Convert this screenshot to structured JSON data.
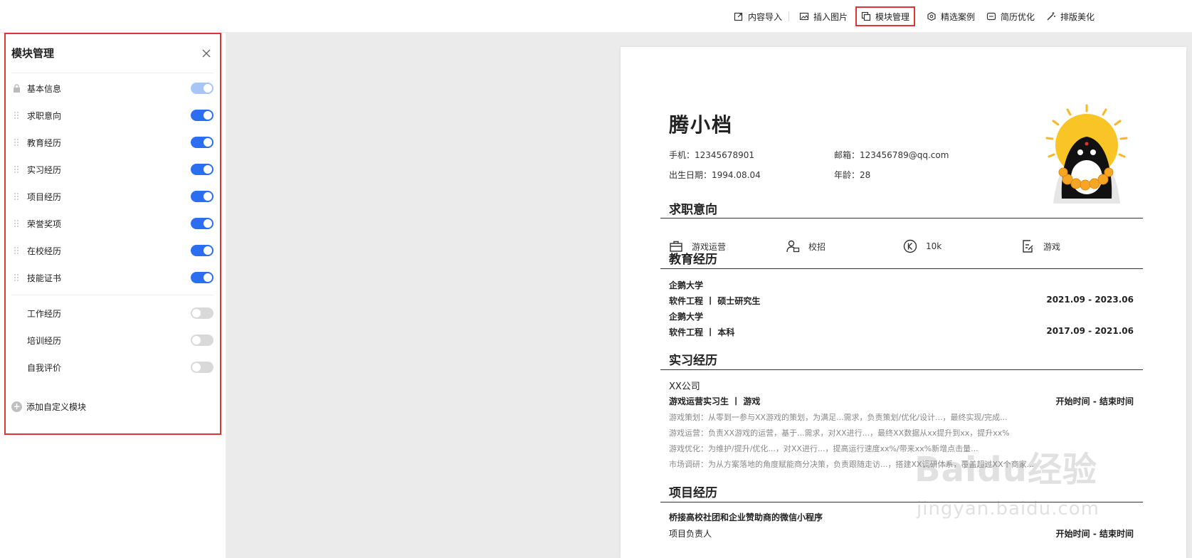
{
  "toolbar": {
    "items": [
      {
        "label": "内容导入",
        "icon": "import-icon"
      },
      {
        "label": "插入图片",
        "icon": "image-icon"
      },
      {
        "label": "模块管理",
        "icon": "modules-icon",
        "active": true
      },
      {
        "label": "精选案例",
        "icon": "cases-icon"
      },
      {
        "label": "简历优化",
        "icon": "optimize-icon"
      },
      {
        "label": "排版美化",
        "icon": "beautify-icon"
      }
    ]
  },
  "panel": {
    "title": "模块管理",
    "modules": [
      {
        "label": "基本信息",
        "state": "locked"
      },
      {
        "label": "求职意向",
        "state": "on"
      },
      {
        "label": "教育经历",
        "state": "on"
      },
      {
        "label": "实习经历",
        "state": "on"
      },
      {
        "label": "项目经历",
        "state": "on"
      },
      {
        "label": "荣誉奖项",
        "state": "on"
      },
      {
        "label": "在校经历",
        "state": "on"
      },
      {
        "label": "技能证书",
        "state": "on"
      }
    ],
    "hidden_modules": [
      {
        "label": "工作经历",
        "state": "off"
      },
      {
        "label": "培训经历",
        "state": "off"
      },
      {
        "label": "自我评价",
        "state": "off"
      }
    ],
    "add_label": "添加自定义模块"
  },
  "resume": {
    "name": "腾小档",
    "phone": "手机：12345678901",
    "email": "邮箱：123456789@qq.com",
    "birth": "出生日期：1994.08.04",
    "age": "年龄：28",
    "intent": {
      "title": "求职意向",
      "position": "游戏运营",
      "type": "校招",
      "salary": "10k",
      "industry": "游戏"
    },
    "education": {
      "title": "教育经历",
      "items": [
        {
          "school": "企鹅大学",
          "detail": "软件工程 丨 硕士研究生",
          "time": "2021.09 - 2023.06"
        },
        {
          "school": "企鹅大学",
          "detail": "软件工程 丨 本科",
          "time": "2017.09 - 2021.06"
        }
      ]
    },
    "internship": {
      "title": "实习经历",
      "company": "XX公司",
      "role": "游戏运营实习生 丨 游戏",
      "time": "开始时间 - 结束时间",
      "lines": [
        "游戏策划：从零到一参与XX游戏的策划，为满足...需求，负责策划/优化/设计...，最终实现/完成...",
        "游戏运营：负责XX游戏的运营，基于...需求，对XX进行...，最终XX数据从xx提升到xx，提升xx%",
        "游戏优化：为维护/提升/优化...，对XX进行...，提高运行速度xx%/带来xx%新增点击量...",
        "市场调研：为从方案落地的角度赋能商分决策，负责跟随走访...，搭建XX调研体系，覆盖超过XX个商家..."
      ]
    },
    "project": {
      "title": "项目经历",
      "name": "桥接高校社团和企业赞助商的微信小程序",
      "role": "项目负责人",
      "time": "开始时间 - 结束时间"
    }
  },
  "watermark": {
    "logo": "Baidu经验",
    "url": "jingyan.baidu.com"
  },
  "colors": {
    "accent": "#2b6ef2",
    "highlight": "#e03434",
    "canvas": "#ebebeb"
  }
}
